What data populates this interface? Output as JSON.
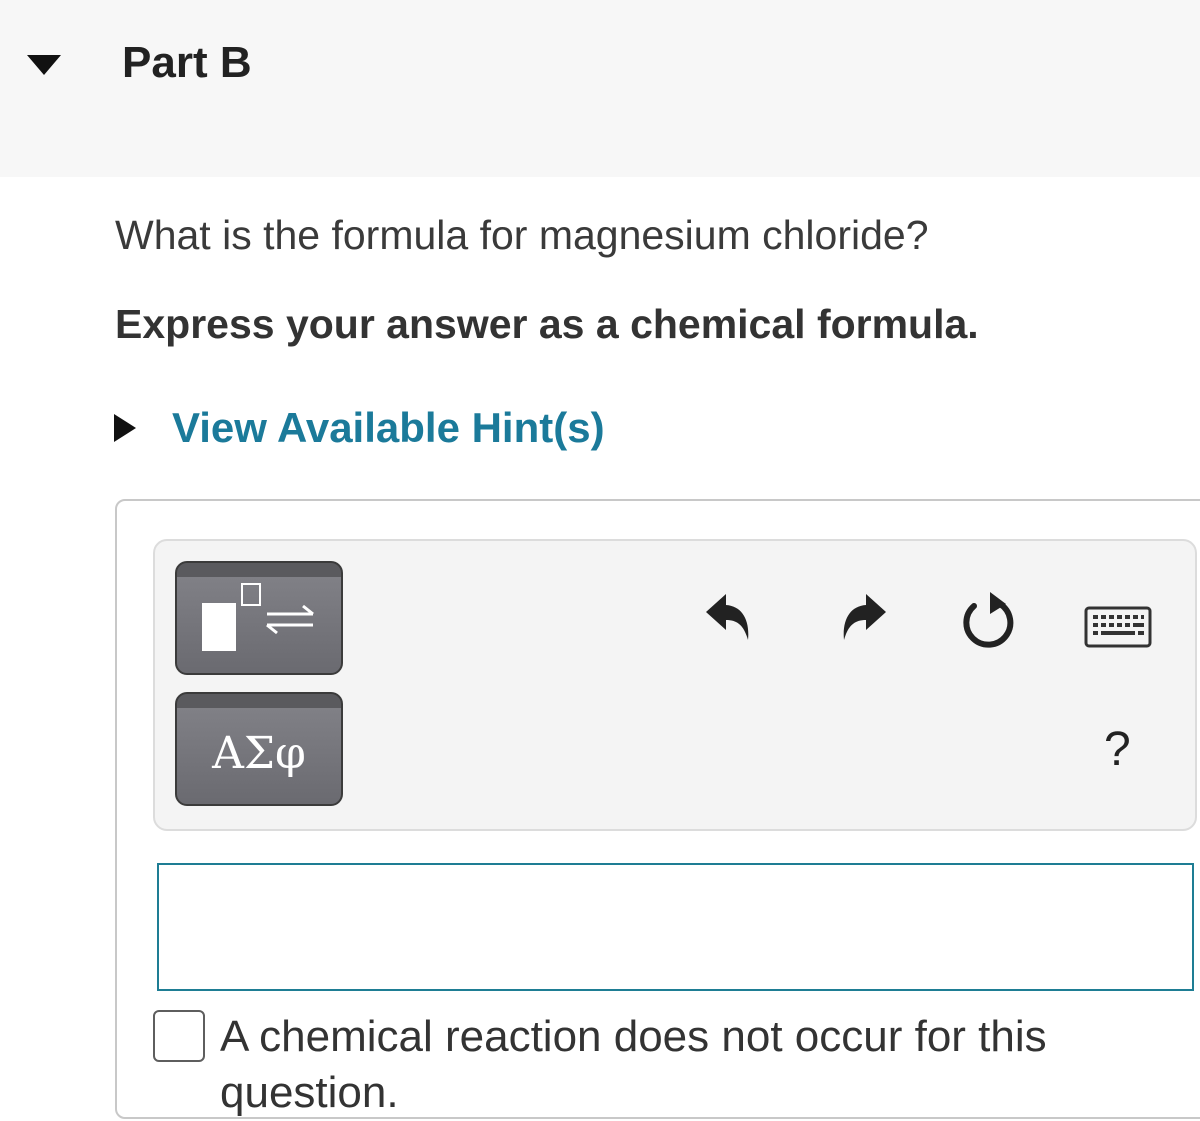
{
  "part": {
    "title": "Part B",
    "expanded": true
  },
  "question": {
    "text": "What is the formula for magnesium chloride?",
    "instruction": "Express your answer as a chemical formula."
  },
  "hint": {
    "label": "View Available Hint(s)",
    "link_color": "#1b7a9a"
  },
  "toolbar": {
    "templates_icon": "templates-equilibrium-icon",
    "symbols_label": "ΑΣφ",
    "undo_icon": "undo-icon",
    "redo_icon": "redo-icon",
    "reset_icon": "reset-icon",
    "keyboard_icon": "keyboard-icon",
    "help_label": "?"
  },
  "answer": {
    "value": "",
    "placeholder": "",
    "border_color": "#1e7d94"
  },
  "no_reaction": {
    "checked": false,
    "label_line1": "A chemical reaction does not occur for this",
    "label_line2": "question."
  }
}
